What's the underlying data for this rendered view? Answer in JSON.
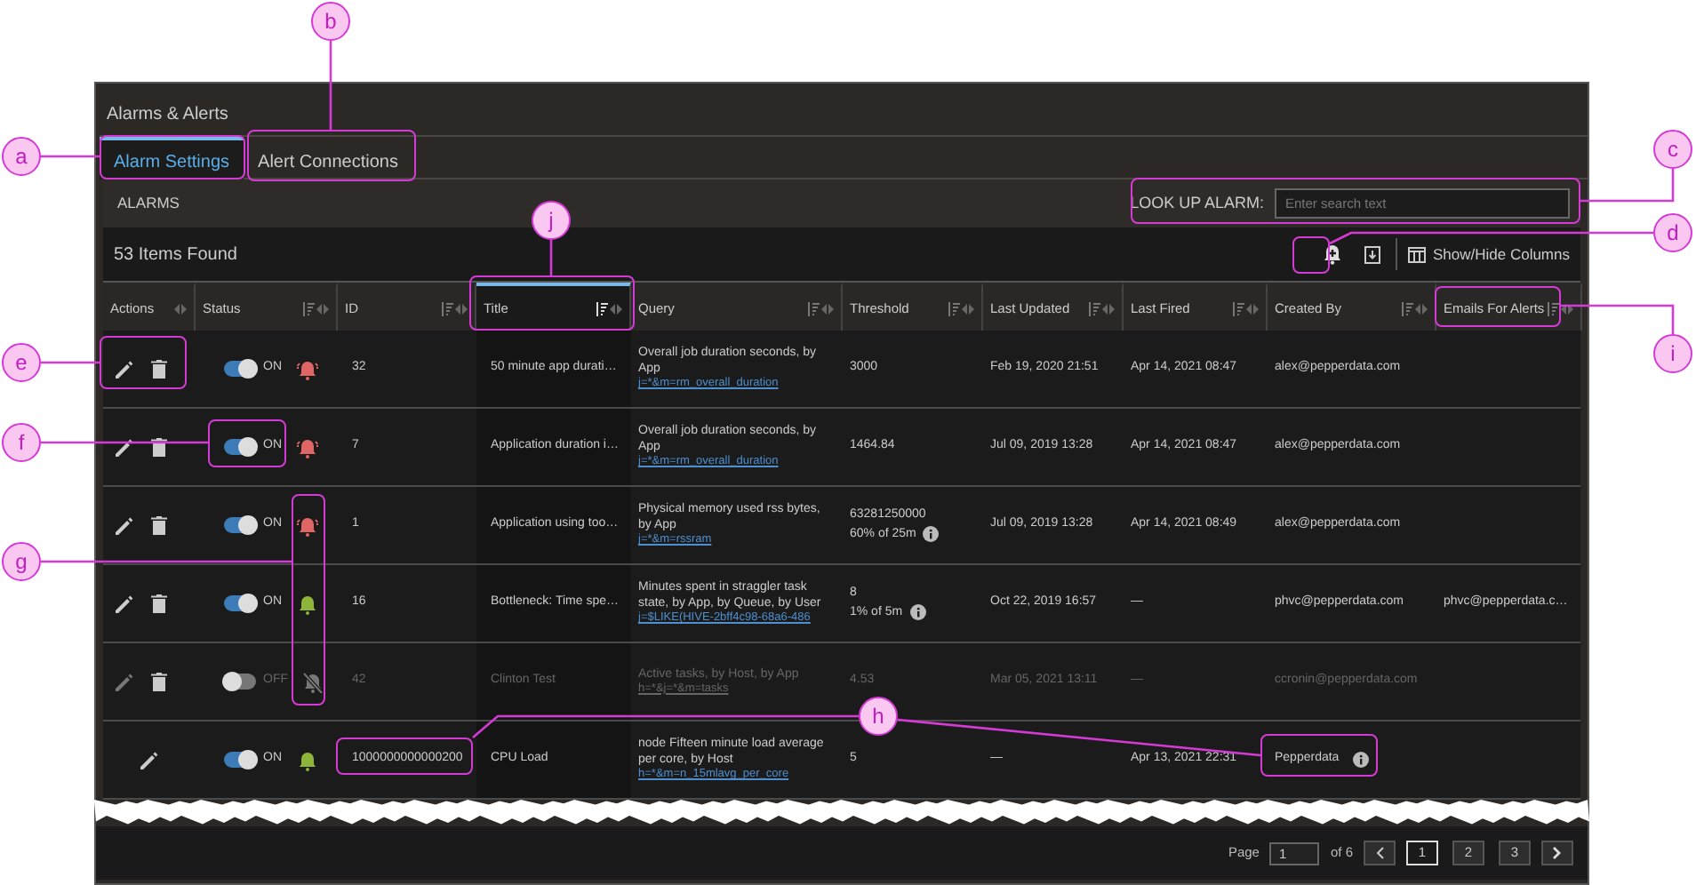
{
  "window": {
    "title": "Alarms & Alerts"
  },
  "tabs": [
    {
      "label": "Alarm Settings",
      "selected": true
    },
    {
      "label": "Alert Connections",
      "selected": false
    }
  ],
  "section": {
    "title": "ALARMS",
    "search_label": "LOOK UP ALARM:",
    "search_placeholder": "Enter search text"
  },
  "toolbar": {
    "count": "53 Items Found",
    "columns_button": "Show/Hide Columns"
  },
  "table": {
    "columns": [
      {
        "label": "Actions",
        "sortable": false,
        "selected": false
      },
      {
        "label": "Status",
        "sortable": true,
        "selected": false
      },
      {
        "label": "ID",
        "sortable": true,
        "selected": false
      },
      {
        "label": "Title",
        "sortable": true,
        "selected": true
      },
      {
        "label": "Query",
        "sortable": true,
        "selected": false
      },
      {
        "label": "Threshold",
        "sortable": true,
        "selected": false
      },
      {
        "label": "Last Updated",
        "sortable": true,
        "selected": false
      },
      {
        "label": "Last Fired",
        "sortable": true,
        "selected": false
      },
      {
        "label": "Created By",
        "sortable": true,
        "selected": false
      },
      {
        "label": "Emails For Alerts",
        "sortable": true,
        "selected": false
      }
    ],
    "rows": [
      {
        "deletable": true,
        "enabled": true,
        "status": "ON",
        "alert_icon": {
          "kind": "ringing"
        },
        "id": "32",
        "title": "50 minute app durati…",
        "query": "Overall job duration seconds, by App",
        "query_link": "j=*&m=rm_overall_duration",
        "threshold": [
          "3000"
        ],
        "threshold_info": false,
        "last_updated": "Feb 19, 2020 21:51",
        "last_fired": "Apr 14, 2021 08:47",
        "created_by": "alex@pepperdata.com",
        "created_info": false
      },
      {
        "deletable": true,
        "enabled": true,
        "status": "ON",
        "alert_icon": {
          "kind": "ringing"
        },
        "id": "7",
        "title": "Application duration i…",
        "query": "Overall job duration seconds, by App",
        "query_link": "j=*&m=rm_overall_duration",
        "threshold": [
          "1464.84"
        ],
        "threshold_info": false,
        "last_updated": "Jul 09, 2019 13:28",
        "last_fired": "Apr 14, 2021 08:47",
        "created_by": "alex@pepperdata.com",
        "created_info": false
      },
      {
        "deletable": true,
        "enabled": true,
        "status": "ON",
        "alert_icon": {
          "kind": "ringing"
        },
        "id": "1",
        "title": "Application using too…",
        "query": "Physical memory used rss bytes, by App",
        "query_link": "j=*&m=rssram",
        "threshold": [
          "63281250000",
          "60% of 25m"
        ],
        "threshold_info": true,
        "last_updated": "Jul 09, 2019 13:28",
        "last_fired": "Apr 14, 2021 08:49",
        "created_by": "alex@pepperdata.com",
        "created_info": false
      },
      {
        "deletable": true,
        "enabled": true,
        "status": "ON",
        "alert_icon": {
          "kind": "bell"
        },
        "id": "16",
        "title": "Bottleneck: Time spe…",
        "query": "Minutes spent in straggler task state, by App, by Queue, by User",
        "query_link": "j=$LIKE(HIVE-2bff4c98-68a6-486",
        "threshold": [
          "8",
          "1% of 5m"
        ],
        "threshold_info": true,
        "last_updated": "Oct 22, 2019 16:57",
        "last_fired": "—",
        "created_by": "phvc@pepperdata.com",
        "created_info": false,
        "emails": "phvc@pepperdata.c…"
      },
      {
        "deletable": true,
        "enabled": false,
        "status": "OFF",
        "alert_icon": {
          "kind": "muted"
        },
        "id": "42",
        "title": "Clinton Test",
        "query": "Active tasks, by Host, by App",
        "query_link": "h=*&j=*&m=tasks",
        "threshold": [
          "4.53"
        ],
        "threshold_info": false,
        "last_updated": "Mar 05, 2021 13:11",
        "last_fired": "—",
        "created_by": "ccronin@pepperdata.com",
        "created_info": false
      },
      {
        "deletable": false,
        "enabled": true,
        "status": "ON",
        "alert_icon": {
          "kind": "bell"
        },
        "id": "1000000000000200",
        "title": "CPU Load",
        "query": "node Fifteen minute load average per core, by Host",
        "query_link": "h=*&m=n_15mlavg_per_core",
        "threshold": [
          "5"
        ],
        "threshold_info": false,
        "last_updated": "—",
        "last_fired": "Apr 13, 2021 22:31",
        "created_by": "Pepperdata",
        "created_info": true
      }
    ]
  },
  "pagination": {
    "label": "Page",
    "value": "1",
    "of": "of 6",
    "pages": [
      {
        "label": "1",
        "selected": true
      },
      {
        "label": "2",
        "selected": false
      },
      {
        "label": "3",
        "selected": false
      }
    ]
  },
  "callouts": [
    {
      "label": "a"
    },
    {
      "label": "b"
    },
    {
      "label": "c"
    },
    {
      "label": "d"
    },
    {
      "label": "e"
    },
    {
      "label": "f"
    },
    {
      "label": "g"
    },
    {
      "label": "h"
    },
    {
      "label": "i"
    },
    {
      "label": "j"
    }
  ]
}
